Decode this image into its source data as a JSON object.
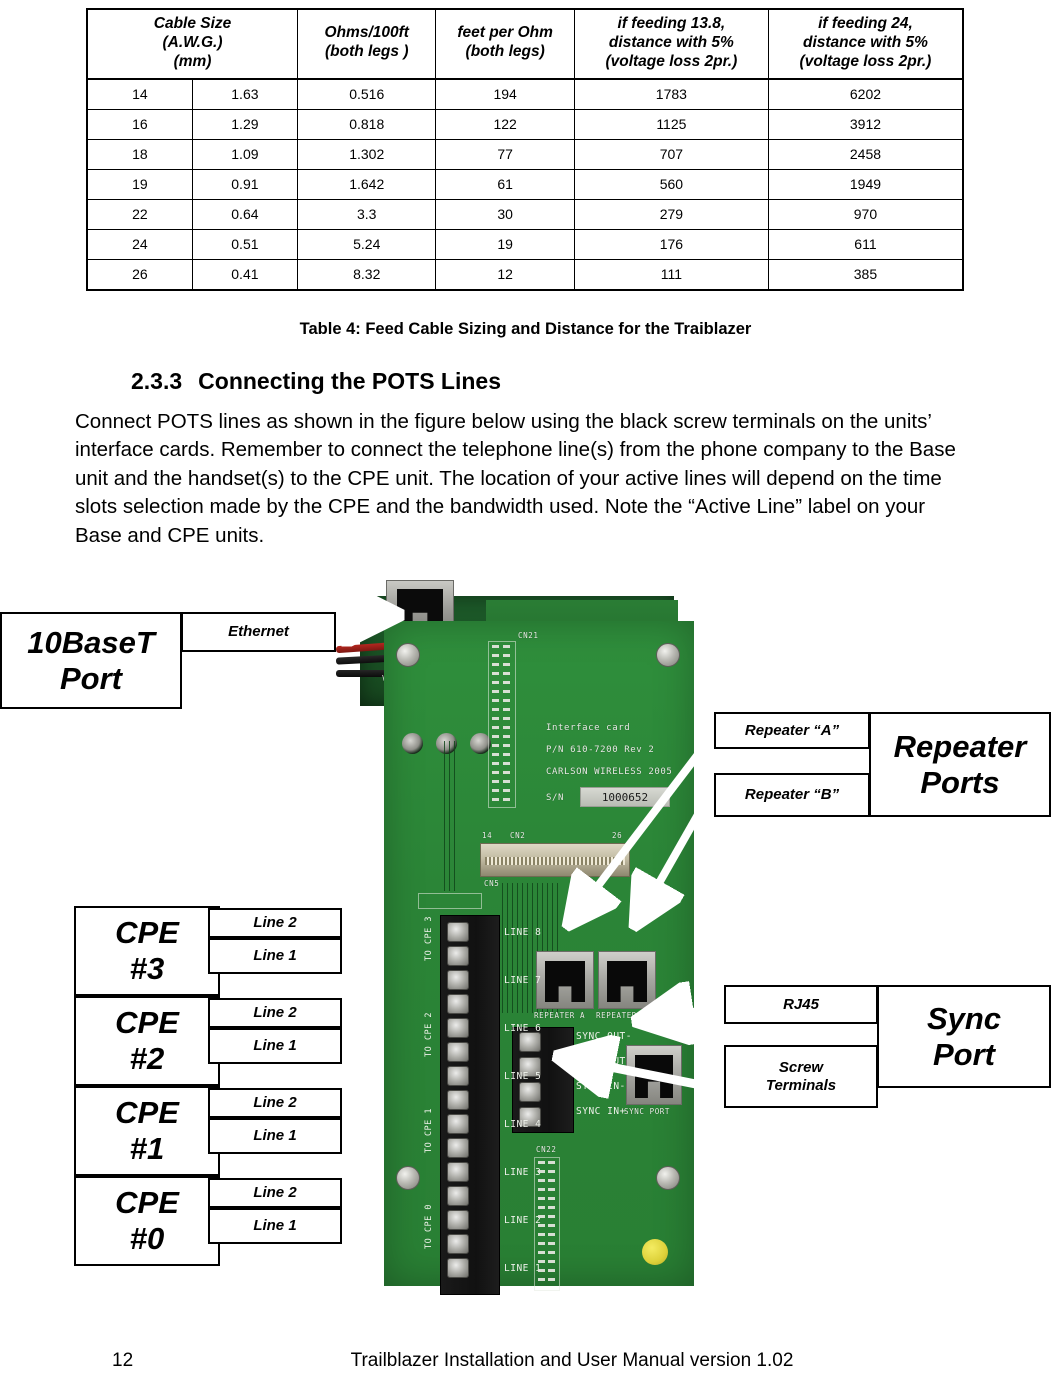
{
  "table": {
    "headers": [
      "Cable Size (A.W.G.) (mm)",
      "Ohms/100ft (both legs )",
      "feet per Ohm (both legs)",
      "if feeding 13.8, distance with 5% (voltage loss 2pr.)",
      "if feeding 24, distance with 5% (voltage loss 2pr.)"
    ],
    "header_lines": {
      "h1": [
        "Cable Size",
        "(A.W.G.)",
        "(mm)"
      ],
      "h2": [
        "Ohms/100ft",
        "(both legs )"
      ],
      "h3": [
        "feet per Ohm",
        "(both legs)"
      ],
      "h4": [
        "if feeding 13.8,",
        "distance with 5%",
        "(voltage loss 2pr.)"
      ],
      "h5": [
        "if feeding 24,",
        "distance with 5%",
        "(voltage loss 2pr.)"
      ]
    },
    "rows": [
      [
        "14",
        "1.63",
        "0.516",
        "194",
        "1783",
        "6202"
      ],
      [
        "16",
        "1.29",
        "0.818",
        "122",
        "1125",
        "3912"
      ],
      [
        "18",
        "1.09",
        "1.302",
        "77",
        "707",
        "2458"
      ],
      [
        "19",
        "0.91",
        "1.642",
        "61",
        "560",
        "1949"
      ],
      [
        "22",
        "0.64",
        "3.3",
        "30",
        "279",
        "970"
      ],
      [
        "24",
        "0.51",
        "5.24",
        "19",
        "176",
        "611"
      ],
      [
        "26",
        "0.41",
        "8.32",
        "12",
        "111",
        "385"
      ]
    ],
    "caption": "Table 4: Feed Cable Sizing and Distance for the Traiblazer"
  },
  "section": {
    "number": "2.3.3",
    "title": "Connecting the POTS Lines",
    "body": "Connect POTS lines as shown in the figure below using the black screw terminals on the units’ interface cards.  Remember to connect the telephone line(s) from the phone company to the Base unit and the handset(s) to the CPE unit.  The location of your active lines will depend on the time slots selection made by the CPE and the bandwidth used.  Note the “Active Line” label on your Base and CPE units."
  },
  "figure": {
    "callouts": {
      "ethernet_group": {
        "title_line1": "10BaseT",
        "title_line2": "Port",
        "sub": "Ethernet"
      },
      "repeater_group": {
        "title_line1": "Repeater",
        "title_line2": "Ports",
        "sub_a": "Repeater “A”",
        "sub_b": "Repeater “B”"
      },
      "sync_group": {
        "title_line1": "Sync",
        "title_line2": "Port",
        "sub_a": "RJ45",
        "sub_b_line1": "Screw",
        "sub_b_line2": "Terminals"
      },
      "cpe": [
        {
          "label_line1": "CPE",
          "label_line2": "#3",
          "line2": "Line 2",
          "line1": "Line 1"
        },
        {
          "label_line1": "CPE",
          "label_line2": "#2",
          "line2": "Line 2",
          "line1": "Line 1"
        },
        {
          "label_line1": "CPE",
          "label_line2": "#1",
          "line2": "Line 2",
          "line1": "Line 1"
        },
        {
          "label_line1": "CPE",
          "label_line2": "#0",
          "line2": "Line 2",
          "line1": "Line 1"
        }
      ]
    },
    "board_silkscreen": {
      "interface_card": "Interface card",
      "part_number": "P/N 610-7200 Rev 2",
      "company": "CARLSON WIRELESS 2005",
      "sn_label": "S/N",
      "serial": "1000652",
      "cn21": "CN21",
      "cn2": "CN2",
      "cn2_pin14": "14",
      "cn2_pin26": "26",
      "cn22": "CN22",
      "cn5": "CN5",
      "repeater_a": "REPEATER A",
      "repeater_b": "REPEATER B",
      "sync_port": "SYNC PORT",
      "sync_terminals": [
        "SYNC OUT-",
        "SYNC OUT+",
        "SYNC IN-",
        "SYNC IN+"
      ],
      "lines": [
        "LINE 8",
        "LINE 7",
        "LINE 6",
        "LINE 5",
        "LINE 4",
        "LINE 3",
        "LINE 2",
        "LINE 1"
      ],
      "cpe_groups": [
        "TO CPE 3",
        "TO CPE 2",
        "TO CPE 1",
        "TO CPE 0"
      ],
      "line8_top": "LINE 8",
      "vdc": "VDC"
    },
    "colors": {
      "pcb_green": "#2d8b3a",
      "silkscreen": "#e9ece6",
      "connector_blue": "#2f63c4",
      "yellow_pad": "#ddd13a"
    }
  },
  "footer": {
    "page_number": "12",
    "text": "Trailblazer Installation and User Manual version 1.02"
  }
}
